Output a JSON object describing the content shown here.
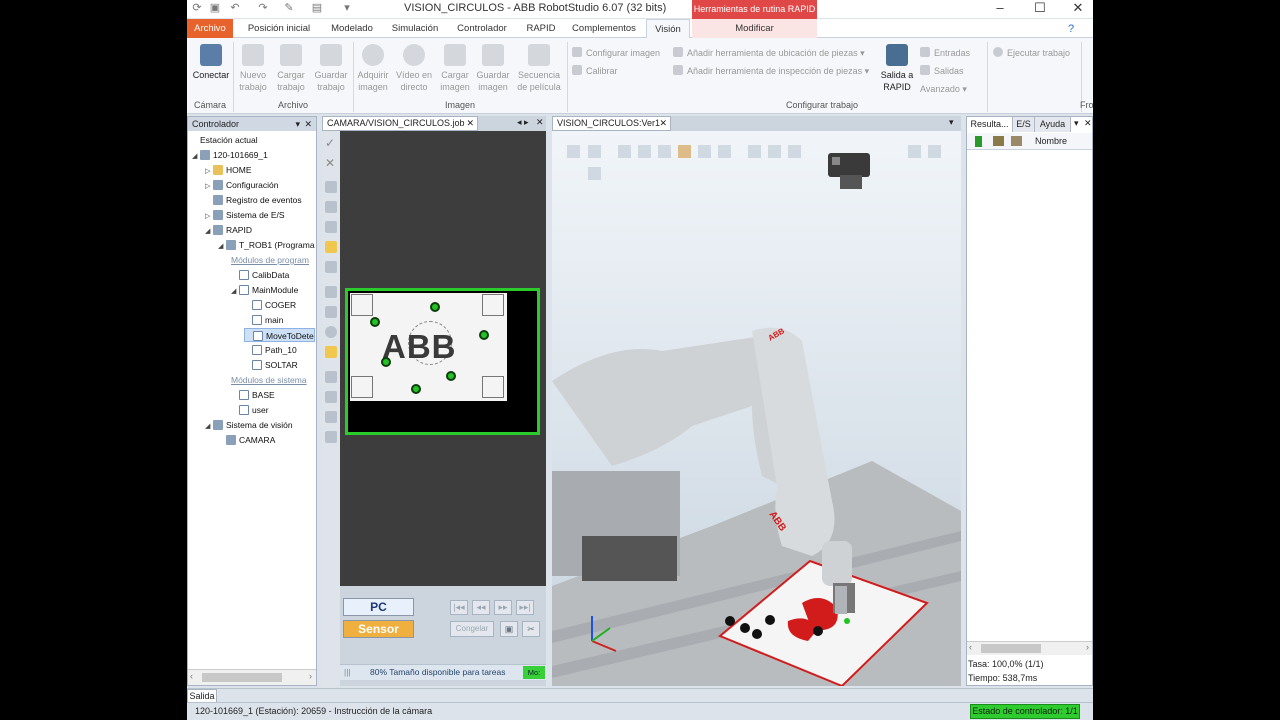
{
  "window": {
    "title": "VISION_CIRCULOS - ABB RobotStudio 6.07 (32 bits)",
    "context_tools_title": "Herramientas de rutina RAPID"
  },
  "tabs": [
    {
      "label": "Archivo"
    },
    {
      "label": "Posición inicial"
    },
    {
      "label": "Modelado"
    },
    {
      "label": "Simulación"
    },
    {
      "label": "Controlador"
    },
    {
      "label": "RAPID"
    },
    {
      "label": "Complementos"
    },
    {
      "label": "Visión"
    },
    {
      "label": "Modificar"
    }
  ],
  "ribbon": {
    "camara_group": {
      "label": "Cámara",
      "conectar": "Conectar"
    },
    "archivo_group": {
      "label": "Archivo",
      "nuevo": "Nuevo trabajo",
      "cargar": "Cargar trabajo",
      "guardar": "Guardar trabajo"
    },
    "imagen_group": {
      "label": "Imagen",
      "adquirir": "Adquirir imagen",
      "video": "Vídeo en directo",
      "cargar": "Cargar imagen",
      "guardar": "Guardar imagen",
      "secuencia": "Secuencia de película"
    },
    "config_group": {
      "label": "Configurar trabajo",
      "configurar_imagen": "Configurar imagen",
      "calibrar": "Calibrar",
      "anadir_ubicacion": "Añadir herramienta de ubicación de piezas",
      "anadir_inspeccion": "Añadir herramienta de inspección de piezas",
      "salida_rapid": "Salida a RAPID",
      "entradas": "Entradas",
      "salidas": "Salidas",
      "avanzado": "Avanzado",
      "ejecutar": "Ejecutar trabajo"
    },
    "fro_label": "Fro"
  },
  "controller_pane": {
    "title": "Controlador",
    "tree": [
      {
        "label": "Estación actual",
        "level": 0,
        "kind": "link"
      },
      {
        "label": "120-101669_1",
        "level": 0,
        "kind": "controller"
      },
      {
        "label": "HOME",
        "level": 1,
        "kind": "folder"
      },
      {
        "label": "Configuración",
        "level": 1,
        "kind": "config"
      },
      {
        "label": "Registro de eventos",
        "level": 1,
        "kind": "log"
      },
      {
        "label": "Sistema de E/S",
        "level": 1,
        "kind": "io"
      },
      {
        "label": "RAPID",
        "level": 1,
        "kind": "rapid"
      },
      {
        "label": "T_ROB1 (Programa",
        "level": 2,
        "kind": "task"
      },
      {
        "label": "Módulos de program",
        "level": 3,
        "kind": "grayed"
      },
      {
        "label": "CalibData",
        "level": 3,
        "kind": "module"
      },
      {
        "label": "MainModule",
        "level": 3,
        "kind": "module"
      },
      {
        "label": "COGER",
        "level": 4,
        "kind": "module"
      },
      {
        "label": "main",
        "level": 4,
        "kind": "module"
      },
      {
        "label": "MoveToDete",
        "level": 4,
        "kind": "module"
      },
      {
        "label": "Path_10",
        "level": 4,
        "kind": "module"
      },
      {
        "label": "SOLTAR",
        "level": 4,
        "kind": "module"
      },
      {
        "label": "Módulos de sistema",
        "level": 3,
        "kind": "grayed"
      },
      {
        "label": "BASE",
        "level": 3,
        "kind": "module"
      },
      {
        "label": "user",
        "level": 3,
        "kind": "module"
      },
      {
        "label": "Sistema de visión",
        "level": 1,
        "kind": "vision"
      },
      {
        "label": "CAMARA",
        "level": 2,
        "kind": "camera"
      }
    ]
  },
  "job_pane": {
    "tab_label": "CAMARA/VISION_CIRCULOS.job",
    "logo_text": "ABB",
    "pc_label": "PC",
    "sensor_label": "Sensor",
    "freeze_label": "Congelar",
    "status_text": "80% Tamaño disponible para tareas",
    "status_mode": "Mo:"
  },
  "view_pane": {
    "tab_label": "VISION_CIRCULOS:Ver1",
    "robot_logo": "ABB"
  },
  "results_pane": {
    "tabs": [
      "Resulta...",
      "E/S",
      "Ayuda"
    ],
    "column_name": "Nombre",
    "rate": "Tasa: 100,0% (1/1)",
    "time": "Tiempo: 538,7ms"
  },
  "output_tab": "Salida",
  "status": {
    "message": "120-101669_1 (Estación): 20659 - Instrucción de la cámara",
    "controller_state": "Estado de controlador: 1/1"
  }
}
